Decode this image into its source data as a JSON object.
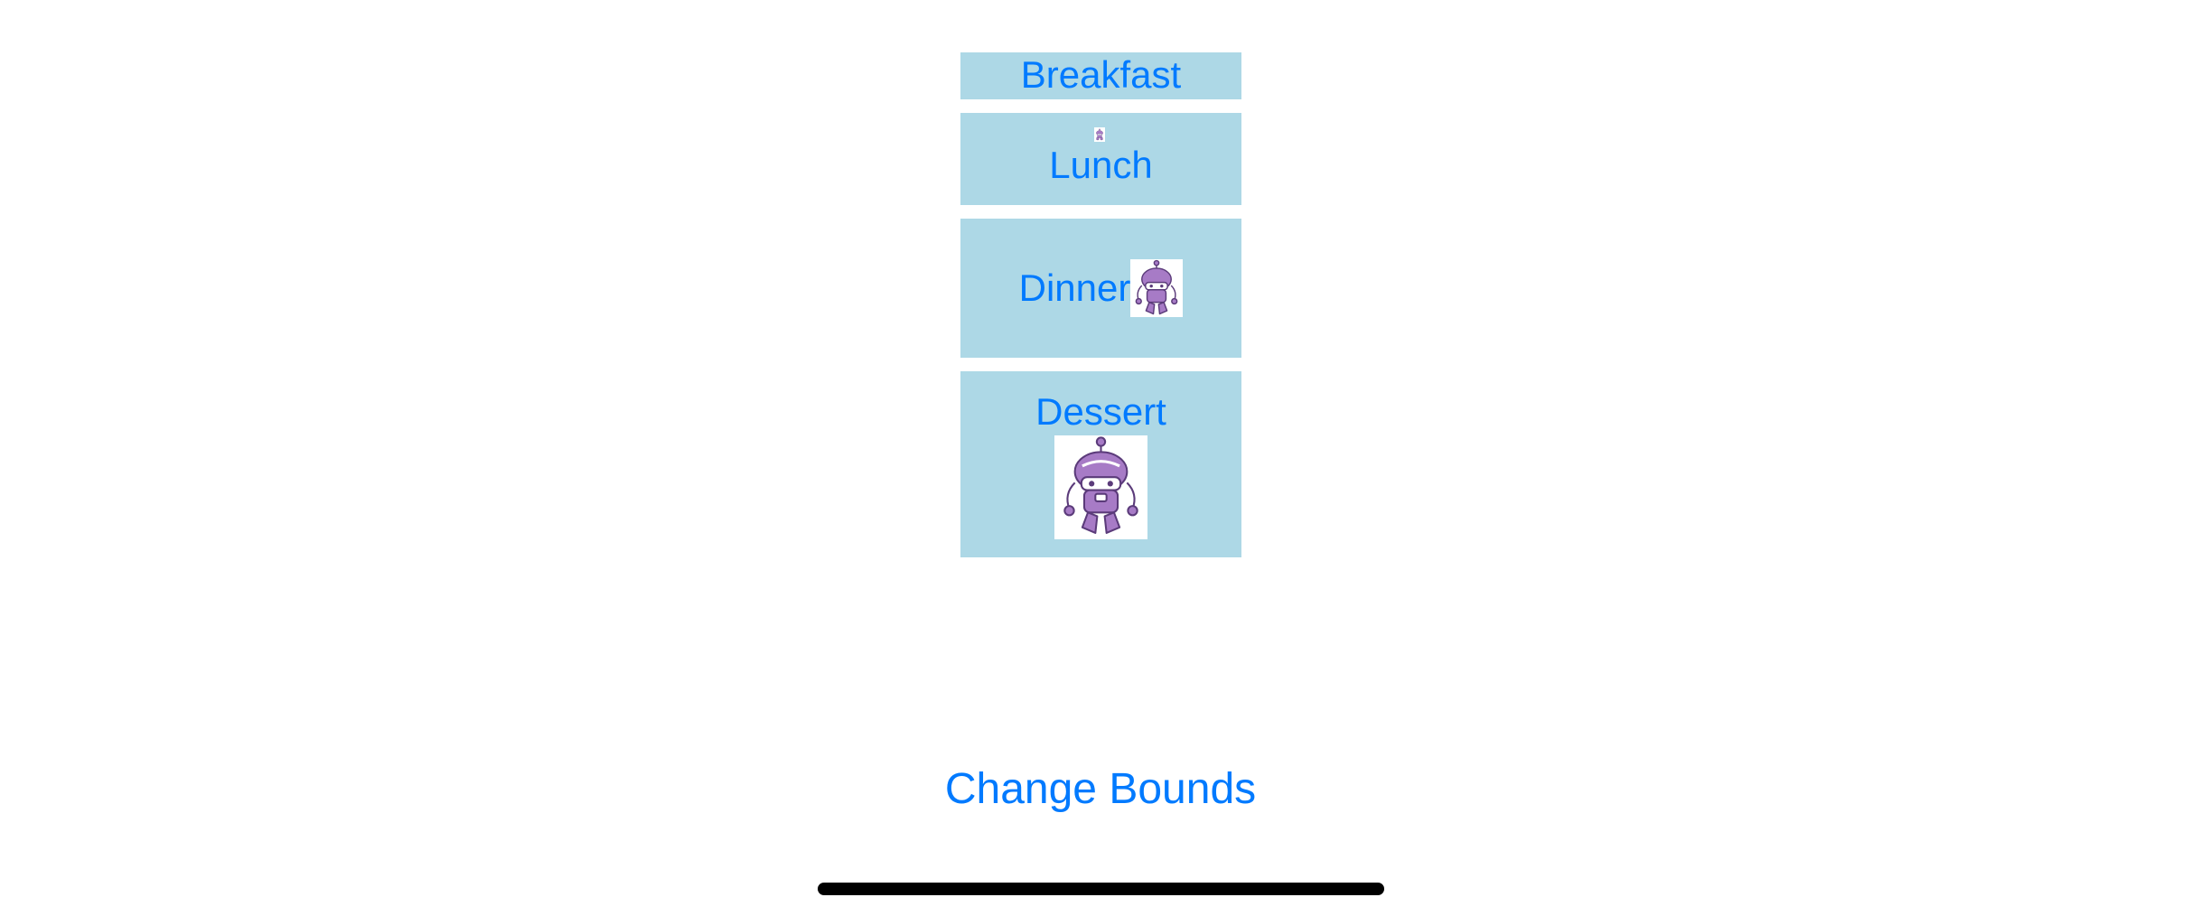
{
  "menu": {
    "breakfast_label": "Breakfast",
    "lunch_label": "Lunch",
    "dinner_label": "Dinner",
    "dessert_label": "Dessert"
  },
  "footer": {
    "change_bounds_label": "Change Bounds"
  },
  "colors": {
    "button_background": "#add8e6",
    "accent_text": "#007aff",
    "robot_purple": "#a77bc6",
    "home_indicator": "#000000"
  },
  "icons": [
    "robot-icon"
  ]
}
